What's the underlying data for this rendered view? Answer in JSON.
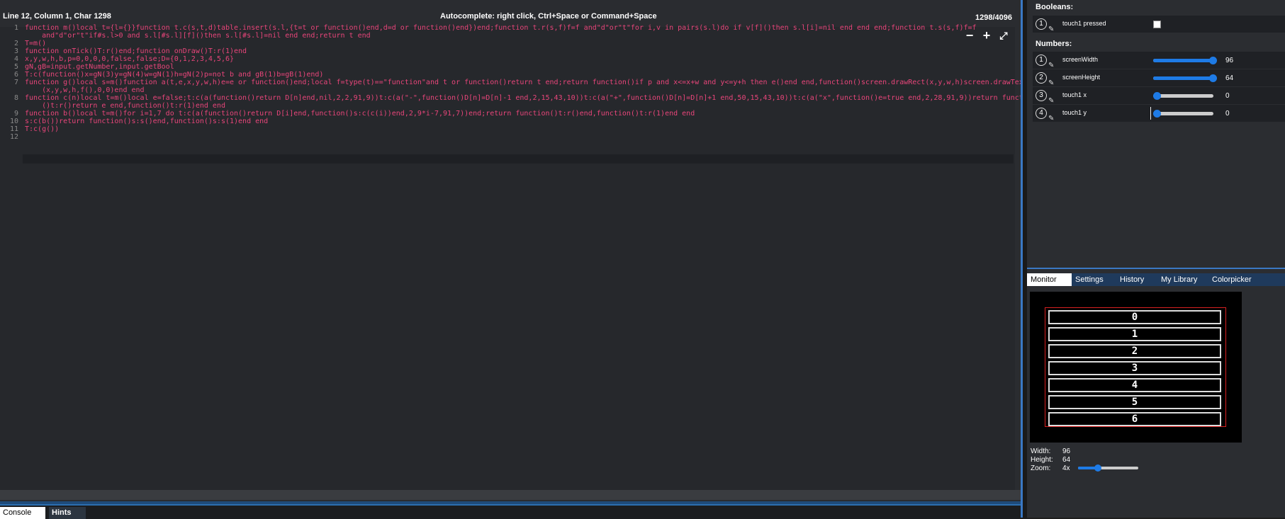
{
  "editor": {
    "cursor_status": "Line 12, Column 1, Char 1298",
    "autocomplete_hint": "Autocomplete: right click, Ctrl+Space or Command+Space",
    "char_count": "1298/4096",
    "line_numbers": [
      "1",
      "2",
      "3",
      "4",
      "5",
      "6",
      "7",
      "8",
      "9",
      "10",
      "11",
      "12"
    ],
    "code_lines": [
      "function m()local t={l={}}function t.c(s,t,d)table.insert(s.l,{t=t or function()end,d=d or function()end})end;function t.r(s,f)f=f and\"d\"or\"t\"for i,v in pairs(s.l)do if v[f]()then s.l[i]=nil end end end;function t.s(s,f)f=f",
      "    and\"d\"or\"t\"if#s.l>0 and s.l[#s.l][f]()then s.l[#s.l]=nil end end;return t end",
      "T=m()",
      "function onTick()T:r()end;function onDraw()T:r(1)end",
      "x,y,w,h,b,p=0,0,0,0,false,false;D={0,1,2,3,4,5,6}",
      "gN,gB=input.getNumber,input.getBool",
      "T:c(function()x=gN(3)y=gN(4)w=gN(1)h=gN(2)p=not b and gB(1)b=gB(1)end)",
      "function g()local s=m()function a(t,e,x,y,w,h)e=e or function()end;local f=type(t)==\"function\"and t or function()return t end;return function()if p and x<=x+w and y<=y+h then e()end end,function()screen.drawRect(x,y,w,h)screen.drawTextBox",
      "    (x,y,w,h,f(),0,0)end end",
      "function c(n)local t=m()local e=false;t:c(a(function()return D[n]end,nil,2,2,91,9))t:c(a(\"-\",function()D[n]=D[n]-1 end,2,15,43,10))t:c(a(\"+\",function()D[n]=D[n]+1 end,50,15,43,10))t:c(a(\"x\",function()e=true end,2,28,91,9))return function",
      "    ()t:r()return e end,function()t:r(1)end end",
      "function b()local t=m()for i=1,7 do t:c(a(function()return D[i]end,function()s:c(c(i))end,2,9*i-7,91,7))end;return function()t:r()end,function()t:r(1)end end",
      "s:c(b())return function()s:s()end,function()s:s(1)end end",
      "T:c(g())",
      ""
    ],
    "zoom_out_icon": "minus-icon",
    "zoom_in_icon": "plus-icon",
    "fullscreen_icon": "expand-icon"
  },
  "bottom_tabs": {
    "console": "Console",
    "hints": "Hints"
  },
  "properties": {
    "booleans_title": "Booleans:",
    "numbers_title": "Numbers:",
    "booleans": [
      {
        "index": "1",
        "label": "touch1 pressed",
        "checked": false
      }
    ],
    "numbers": [
      {
        "index": "1",
        "label": "screenWidth",
        "value": "96",
        "fraction": 1.0
      },
      {
        "index": "2",
        "label": "screenHeight",
        "value": "64",
        "fraction": 1.0
      },
      {
        "index": "3",
        "label": "touch1 x",
        "value": "0",
        "fraction": 0.0
      },
      {
        "index": "4",
        "label": "touch1 y",
        "value": "0",
        "fraction": 0.0
      }
    ]
  },
  "right_tabs": [
    "Monitor",
    "Settings",
    "History",
    "My Library",
    "Colorpicker"
  ],
  "monitor": {
    "buttons": [
      "0",
      "1",
      "2",
      "3",
      "4",
      "5",
      "6"
    ],
    "width_label": "Width:",
    "width_value": "96",
    "height_label": "Height:",
    "height_value": "64",
    "zoom_label": "Zoom:",
    "zoom_value": "4x",
    "zoom_fraction": 0.33
  },
  "colors": {
    "accent": "#1e7be6",
    "keyword": "#e8457a",
    "frame": "#d92020"
  }
}
